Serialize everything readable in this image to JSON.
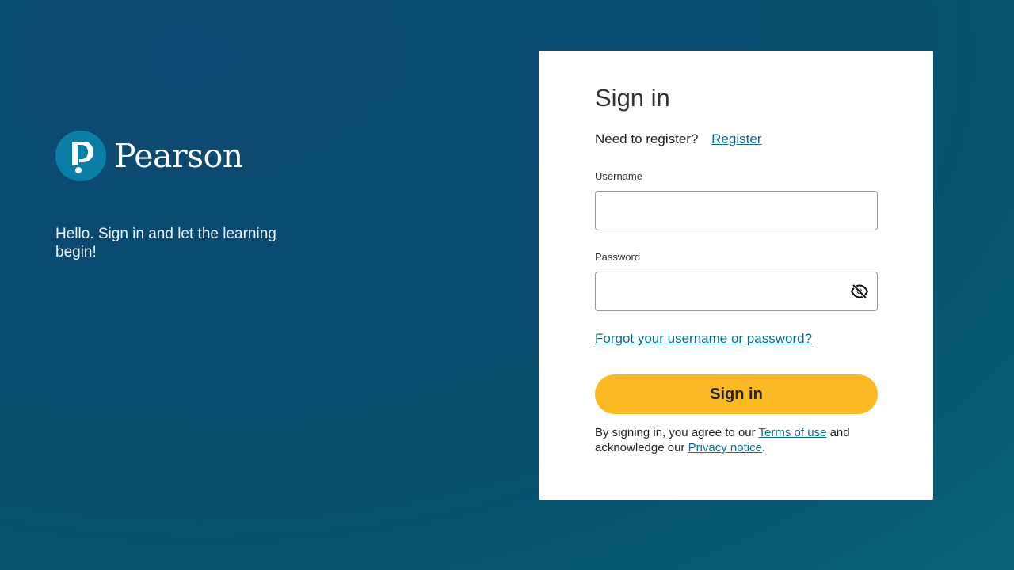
{
  "brand": {
    "name": "Pearson",
    "tagline": "Hello. Sign in and let the learning begin!",
    "color": "#0b7ea6"
  },
  "form": {
    "title": "Sign in",
    "register_prompt": "Need to register?",
    "register_link": "Register",
    "username_label": "Username",
    "username_value": "",
    "password_label": "Password",
    "password_value": "",
    "password_toggle_icon": "eye-slash-icon",
    "forgot_link": "Forgot your username or password?",
    "submit_label": "Sign in",
    "submit_color": "#fbb923",
    "terms_prefix": "By signing in, you agree to our",
    "terms_link": "Terms of use",
    "terms_middle": "and acknowledge our",
    "privacy_link": "Privacy notice",
    "terms_suffix": "."
  },
  "colors": {
    "link": "#0a6e8a",
    "background": "#0a4a70"
  }
}
